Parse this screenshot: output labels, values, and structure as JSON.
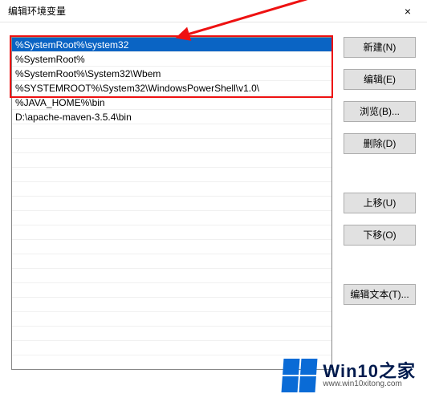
{
  "window": {
    "title": "编辑环境变量",
    "close_icon": "×"
  },
  "list": {
    "items": [
      "%SystemRoot%\\system32",
      "%SystemRoot%",
      "%SystemRoot%\\System32\\Wbem",
      "%SYSTEMROOT%\\System32\\WindowsPowerShell\\v1.0\\",
      "%JAVA_HOME%\\bin",
      "D:\\apache-maven-3.5.4\\bin"
    ],
    "selected_index": 0
  },
  "buttons": {
    "new": "新建(N)",
    "edit": "编辑(E)",
    "browse": "浏览(B)...",
    "delete": "删除(D)",
    "move_up": "上移(U)",
    "move_down": "下移(O)",
    "edit_text": "编辑文本(T)..."
  },
  "watermark": {
    "main": "Win10之家",
    "sub": "www.win10xitong.com"
  },
  "annotation": {
    "overlay_label": "highlight-box",
    "arrow_label": "arrow"
  },
  "colors": {
    "selection_bg": "#0a64c4",
    "annotation": "#e11",
    "button_bg": "#e1e1e1",
    "logo": "#0a6bd6"
  }
}
